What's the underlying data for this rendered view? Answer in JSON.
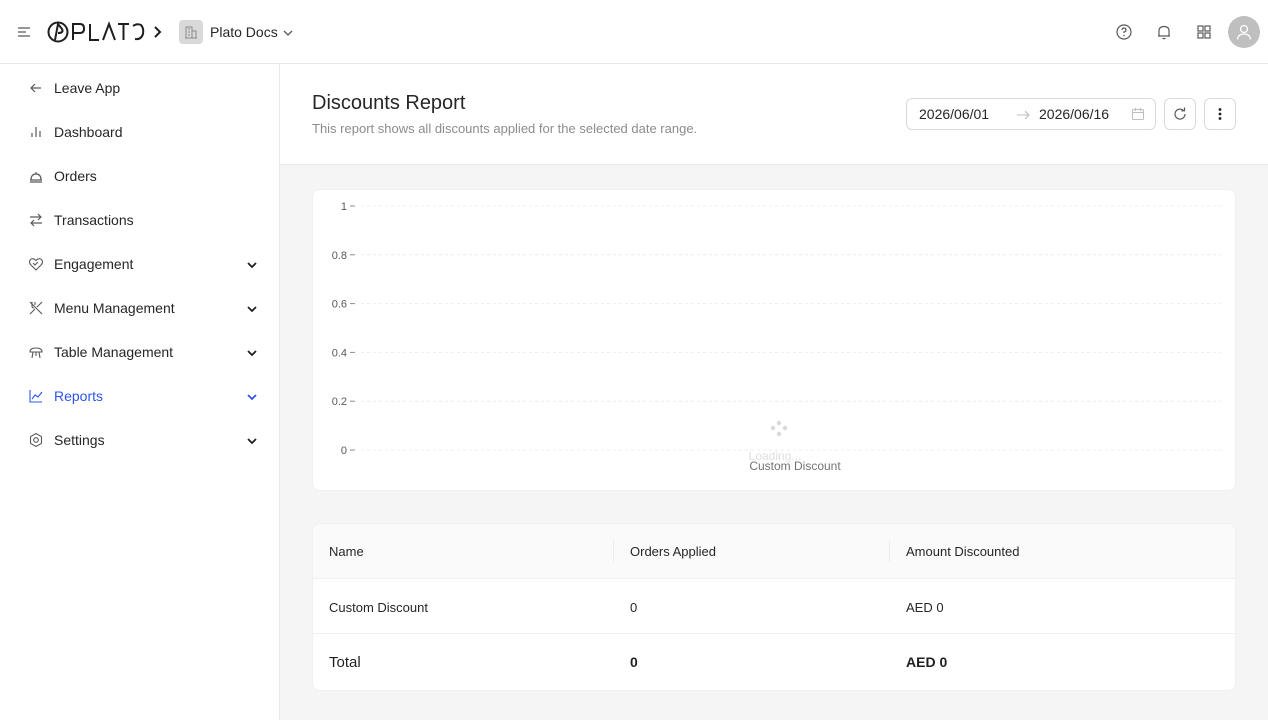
{
  "topbar": {
    "brand": "PLATO",
    "org_name": "Plato Docs",
    "icons": [
      "menu-icon",
      "chevron-right-icon",
      "building-icon",
      "chevron-down-icon",
      "help-icon",
      "bell-icon",
      "apps-grid-icon",
      "user-avatar-icon"
    ]
  },
  "sidebar": {
    "items": [
      {
        "label": "Leave App",
        "icon": "arrow-left-icon",
        "expandable": false
      },
      {
        "label": "Dashboard",
        "icon": "bar-chart-icon",
        "expandable": false
      },
      {
        "label": "Orders",
        "icon": "cloche-icon",
        "expandable": false
      },
      {
        "label": "Transactions",
        "icon": "swap-icon",
        "expandable": false
      },
      {
        "label": "Engagement",
        "icon": "heart-handshake-icon",
        "expandable": true
      },
      {
        "label": "Menu Management",
        "icon": "utensils-icon",
        "expandable": true
      },
      {
        "label": "Table Management",
        "icon": "table-icon",
        "expandable": true
      },
      {
        "label": "Reports",
        "icon": "line-chart-icon",
        "expandable": true,
        "active": true
      },
      {
        "label": "Settings",
        "icon": "gear-icon",
        "expandable": true
      }
    ],
    "active_color": "#2f54eb"
  },
  "header": {
    "title": "Discounts Report",
    "subtitle": "This report shows all discounts applied for the selected date range.",
    "date_start": "2026/06/01",
    "date_end": "2026/06/16"
  },
  "chart_data": {
    "type": "bar",
    "categories": [
      "Custom Discount"
    ],
    "values": [
      0
    ],
    "ylim": [
      0,
      1
    ],
    "yticks": [
      "1",
      "0.8",
      "0.6",
      "0.4",
      "0.2",
      "0"
    ],
    "grid": true,
    "loading_text": "Loading..."
  },
  "table": {
    "columns": [
      "Name",
      "Orders Applied",
      "Amount Discounted"
    ],
    "rows": [
      [
        "Custom Discount",
        "0",
        "AED 0"
      ]
    ],
    "total": [
      "Total",
      "0",
      "AED 0"
    ]
  }
}
